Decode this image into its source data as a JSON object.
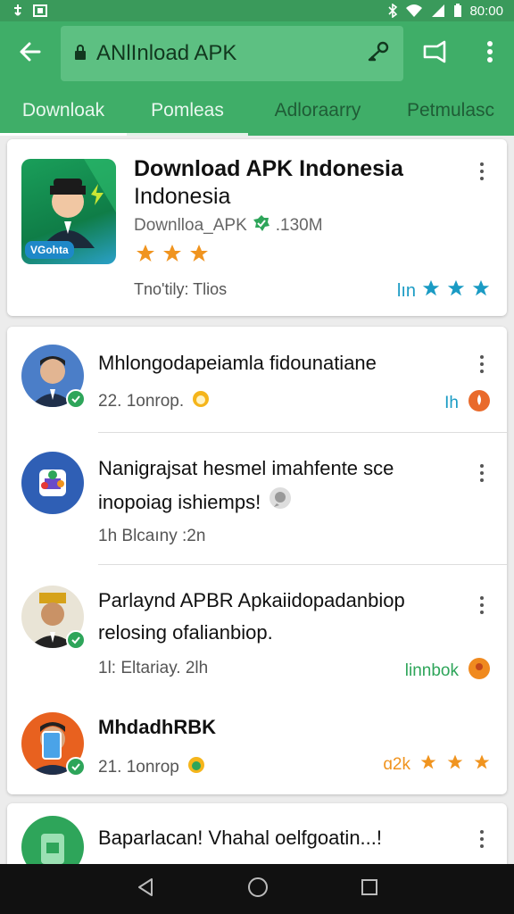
{
  "status_bar": {
    "time": "80:00"
  },
  "app_bar": {
    "search_query": "ANlInload APK"
  },
  "tabs": [
    {
      "label": "Downloak",
      "active": true
    },
    {
      "label": "Pomleas",
      "active": true
    },
    {
      "label": "Adloraarry",
      "active": false
    },
    {
      "label": "Petmulasc",
      "active": false
    }
  ],
  "featured": {
    "icon_label": "VGohta",
    "title_line1": "Download APK Indonesia",
    "title_line2": "Indonesia",
    "subtitle_left": "Downlloa_APK",
    "subtitle_right": ".130M",
    "star_count": 3,
    "meta": "Tno'tily: Tlios",
    "rating_text": "lın"
  },
  "items": [
    {
      "title": "Mhlongodapeiamla fidounatiane",
      "meta": "22. 1onrop.",
      "right_text": "Ih"
    },
    {
      "title_line1": "Nanigrajsat hesmel imahfente sce",
      "title_line2": "inopoiag ishiemps!",
      "meta": "1h Blcaıny :2n"
    },
    {
      "title_line1": "Parlaynd APBR Apkaiidopadanbiop",
      "title_line2": "relosing ofalianbiop.",
      "meta": "1l: Eltariay. 2lh",
      "right_text": "linnbok"
    },
    {
      "title": "MhdadhRBK",
      "meta": "21. 1onrop",
      "right_text": "ɑ2k"
    },
    {
      "title": "Baparlacan! Vhahal oelfgoatin...!"
    }
  ],
  "colors": {
    "primary": "#3fae68",
    "status_bar": "#3a9a5b",
    "search_bg": "#5dc082",
    "star": "#f0941f",
    "teal_star": "#1a9bc4",
    "verified": "#2ea55a"
  },
  "icons": [
    "back-arrow-icon",
    "lock-icon",
    "key-icon",
    "share-icon",
    "more-vert-icon",
    "star-icon",
    "check-badge-icon",
    "nav-back-icon",
    "nav-home-icon",
    "nav-recents-icon"
  ]
}
